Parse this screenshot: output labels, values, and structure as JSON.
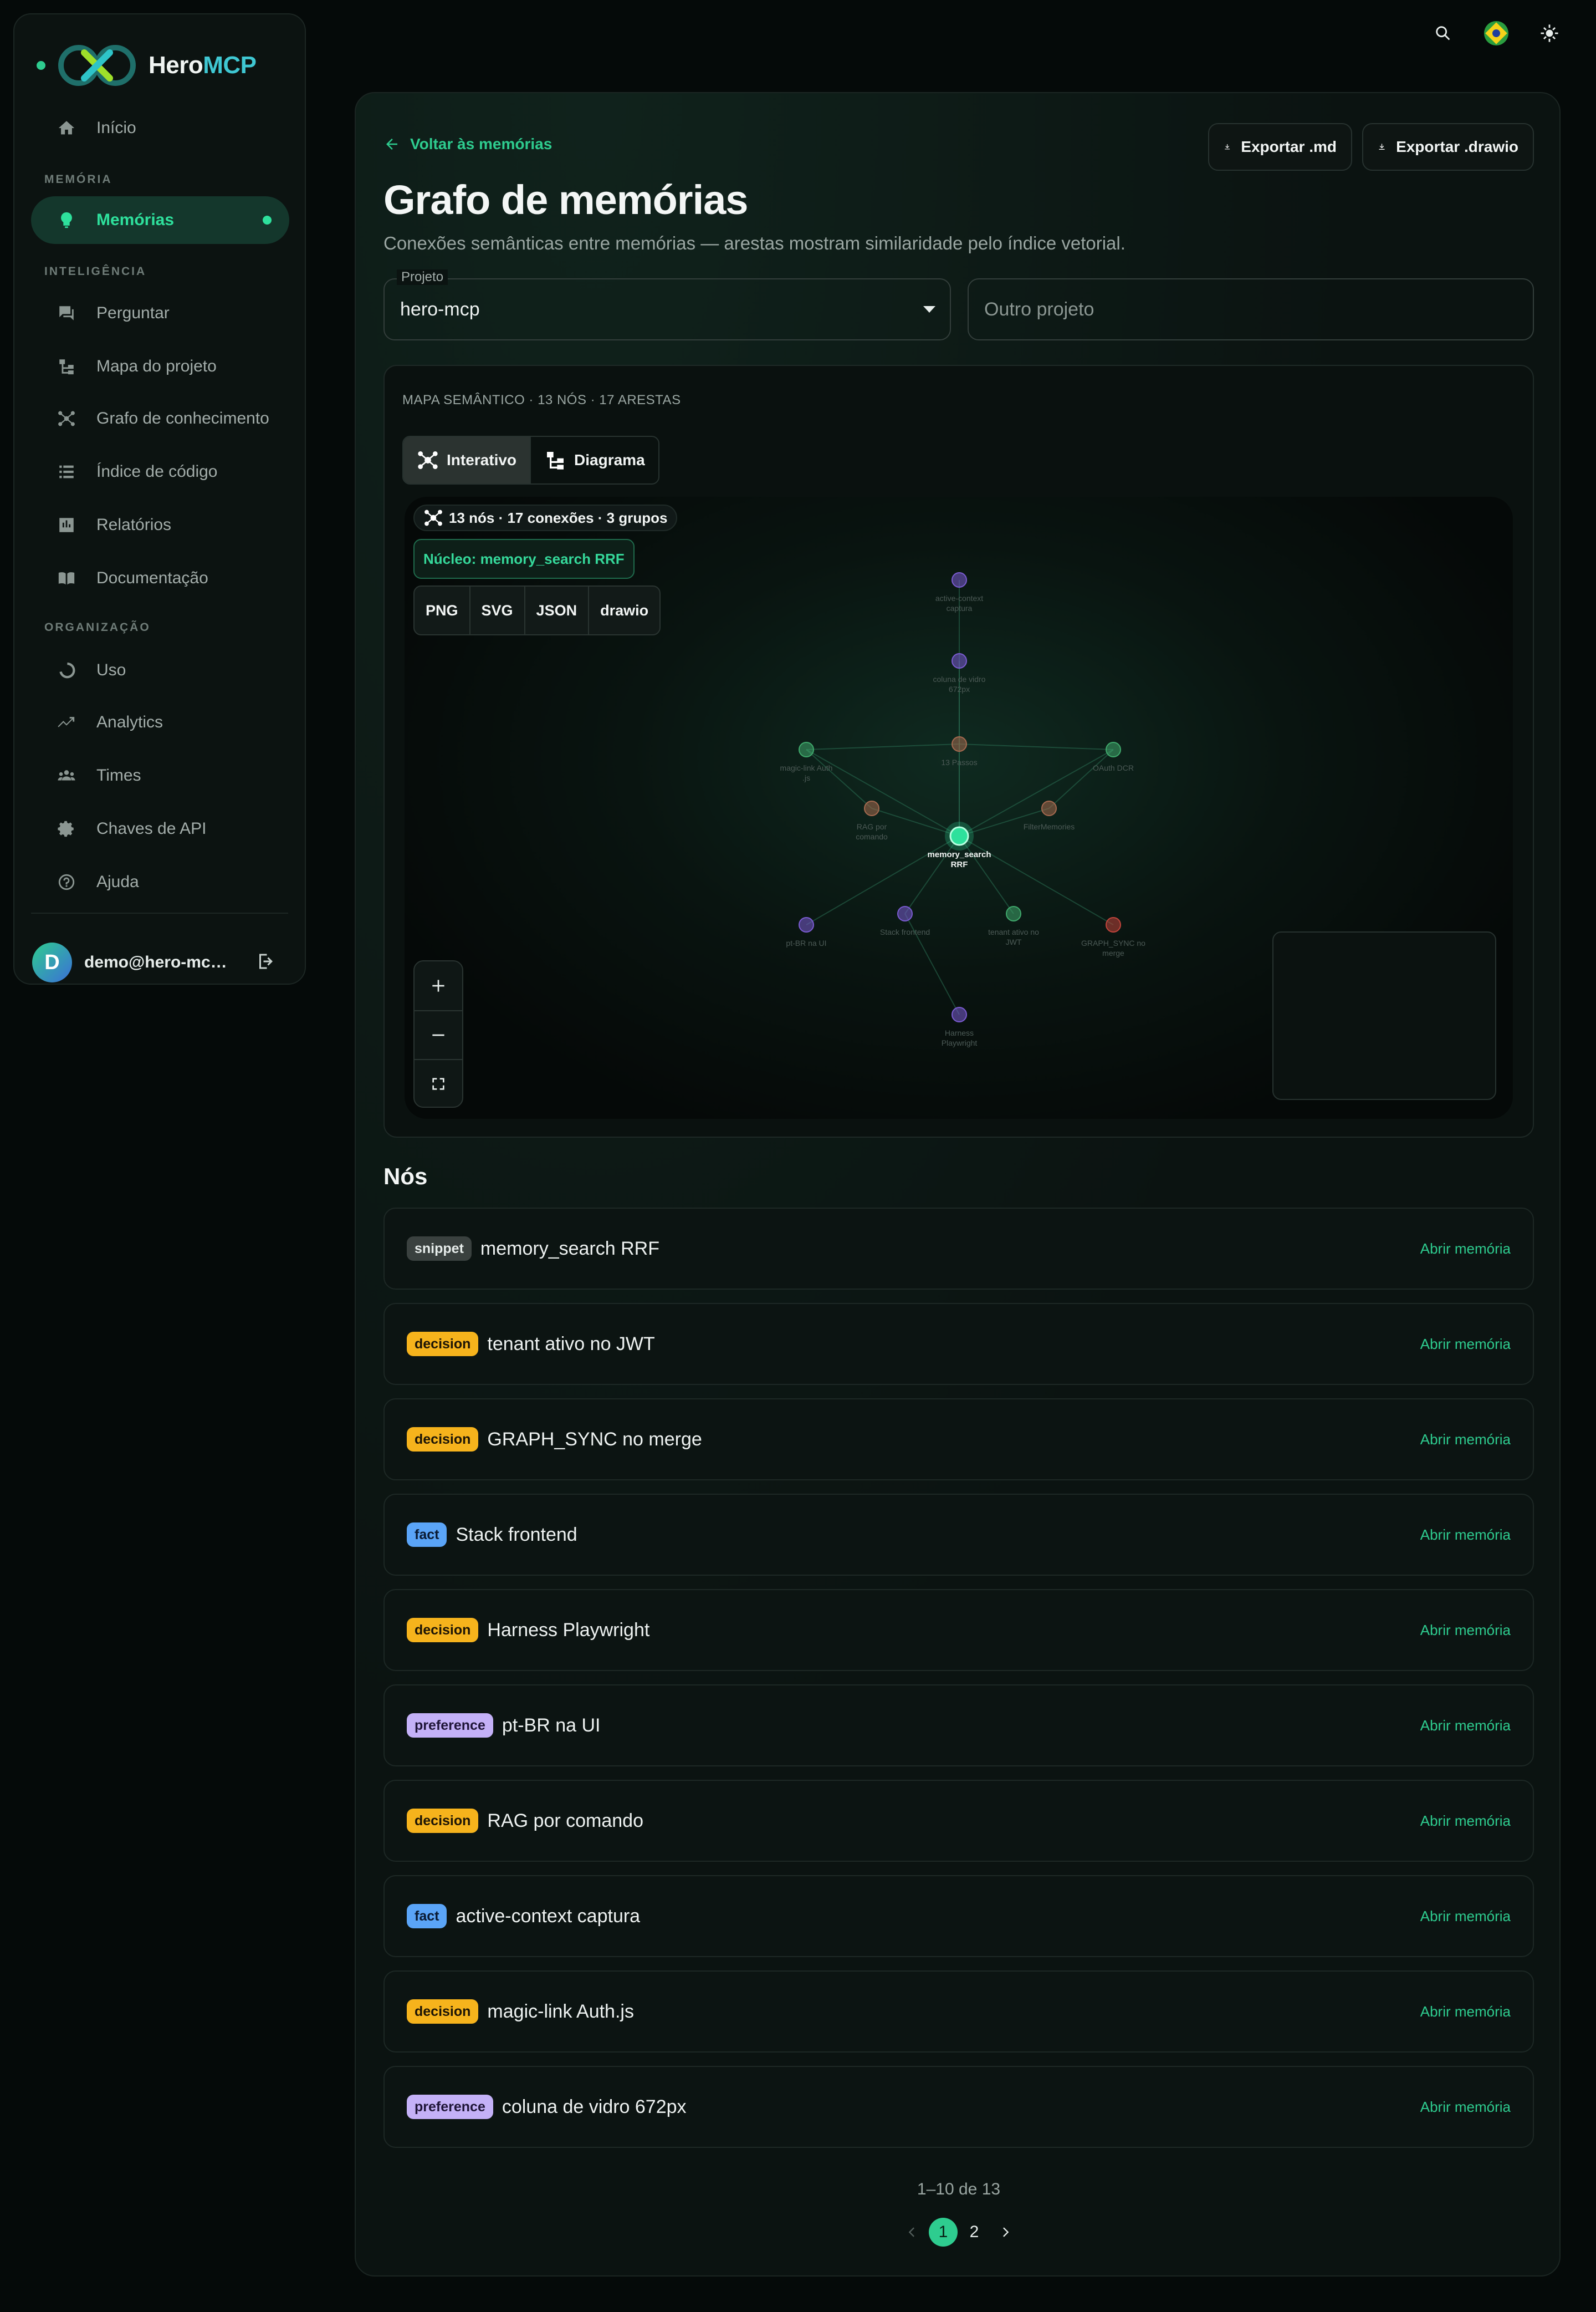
{
  "brand": {
    "name_part1": "Hero",
    "name_part2": "MCP"
  },
  "sidebar": {
    "sections": {
      "memoria": "MEMÓRIA",
      "inteligencia": "INTELIGÊNCIA",
      "organizacao": "ORGANIZAÇÃO"
    },
    "items": {
      "inicio": "Início",
      "memorias": "Memórias",
      "perguntar": "Perguntar",
      "mapa": "Mapa do projeto",
      "grafo": "Grafo de conhecimento",
      "indice": "Índice de código",
      "relatorios": "Relatórios",
      "documentacao": "Documentação",
      "uso": "Uso",
      "analytics": "Analytics",
      "times": "Times",
      "chaves": "Chaves de API",
      "ajuda": "Ajuda"
    },
    "user": {
      "initial": "D",
      "email": "demo@hero-mcp.dev"
    }
  },
  "topbar": {
    "icons": [
      "search-icon",
      "flag-brazil-icon",
      "sun-icon"
    ]
  },
  "header": {
    "back_label": "Voltar às memórias",
    "export_md": "Exportar .md",
    "export_drawio": "Exportar .drawio",
    "title": "Grafo de memórias",
    "subtitle": "Conexões semânticas entre memórias — arestas mostram similaridade pelo índice vetorial."
  },
  "filters": {
    "project_label": "Projeto",
    "project_value": "hero-mcp",
    "other_placeholder": "Outro projeto"
  },
  "map": {
    "caption": "MAPA SEMÂNTICO · 13 NÓS · 17 ARESTAS",
    "view_interactive": "Interativo",
    "view_diagram": "Diagrama",
    "stats": "13 nós · 17 conexões · 3 grupos",
    "core": "Núcleo: memory_search RRF",
    "formats": [
      "PNG",
      "SVG",
      "JSON",
      "drawio"
    ],
    "nodes": [
      {
        "label1": "active-context",
        "label2": "captura",
        "color": "#7a5bd1"
      },
      {
        "label1": "coluna de vidro",
        "label2": "672px",
        "color": "#7a5bd1"
      },
      {
        "label1": "magic-link Auth",
        "label2": ".js",
        "color": "#3fa86b"
      },
      {
        "label1": "13 Passos",
        "label2": "",
        "color": "#a5694f"
      },
      {
        "label1": "OAuth DCR",
        "label2": "",
        "color": "#3fa86b"
      },
      {
        "label1": "RAG por",
        "label2": "comando",
        "color": "#a5694f"
      },
      {
        "label1": "FilterMemories",
        "label2": "",
        "color": "#a5694f"
      },
      {
        "label1": "memory_search",
        "label2": "RRF",
        "color": "#2ee09c"
      },
      {
        "label1": "pt-BR na UI",
        "label2": "",
        "color": "#7a5bd1"
      },
      {
        "label1": "Stack frontend",
        "label2": "",
        "color": "#7a5bd1"
      },
      {
        "label1": "tenant ativo no",
        "label2": "JWT",
        "color": "#3fa86b"
      },
      {
        "label1": "GRAPH_SYNC no",
        "label2": "merge",
        "color": "#c0443b"
      },
      {
        "label1": "Harness",
        "label2": "Playwright",
        "color": "#7a5bd1"
      }
    ]
  },
  "nodes_section": {
    "title": "Nós",
    "open_label": "Abrir memória",
    "rows": [
      {
        "type": "snippet",
        "title": "memory_search RRF"
      },
      {
        "type": "decision",
        "title": "tenant ativo no JWT"
      },
      {
        "type": "decision",
        "title": "GRAPH_SYNC no merge"
      },
      {
        "type": "fact",
        "title": "Stack frontend"
      },
      {
        "type": "decision",
        "title": "Harness Playwright"
      },
      {
        "type": "preference",
        "title": "pt-BR na UI"
      },
      {
        "type": "decision",
        "title": "RAG por comando"
      },
      {
        "type": "fact",
        "title": "active-context captura"
      },
      {
        "type": "decision",
        "title": "magic-link Auth.js"
      },
      {
        "type": "preference",
        "title": "coluna de vidro 672px"
      }
    ]
  },
  "pagination": {
    "info": "1–10 de 13",
    "pages": [
      "1",
      "2"
    ],
    "current": "1"
  },
  "colors": {
    "accent": "#2ecc8f",
    "decision": "#f6b31c",
    "fact": "#5aa4f7",
    "preference": "#c4b1f7",
    "snippet": "#3a413f"
  }
}
